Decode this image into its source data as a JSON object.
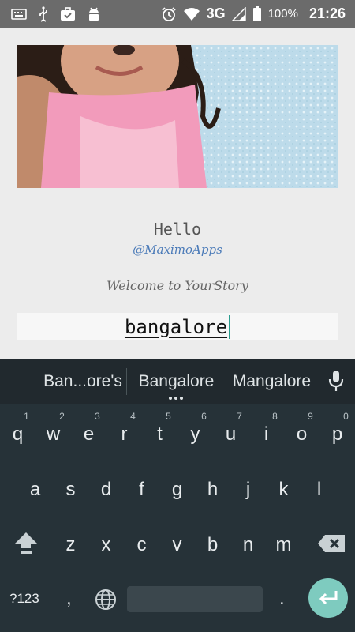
{
  "status_bar": {
    "network": "3G",
    "battery": "100%",
    "time": "21:26"
  },
  "content": {
    "greeting": "Hello",
    "handle": "@MaximoApps",
    "welcome": "Welcome to YourStory",
    "input_value": "bangalore"
  },
  "keyboard": {
    "suggestions": [
      "Ban...ore's",
      "Bangalore",
      "Mangalore"
    ],
    "row1": [
      {
        "key": "q",
        "num": "1"
      },
      {
        "key": "w",
        "num": "2"
      },
      {
        "key": "e",
        "num": "3"
      },
      {
        "key": "r",
        "num": "4"
      },
      {
        "key": "t",
        "num": "5"
      },
      {
        "key": "y",
        "num": "6"
      },
      {
        "key": "u",
        "num": "7"
      },
      {
        "key": "i",
        "num": "8"
      },
      {
        "key": "o",
        "num": "9"
      },
      {
        "key": "p",
        "num": "0"
      }
    ],
    "row2": [
      "a",
      "s",
      "d",
      "f",
      "g",
      "h",
      "j",
      "k",
      "l"
    ],
    "row3": [
      "z",
      "x",
      "c",
      "v",
      "b",
      "n",
      "m"
    ],
    "symbols_label": "?123",
    "comma": ",",
    "period": "."
  },
  "colors": {
    "status_bar": "#6b6b6b",
    "keyboard_bg": "#263238",
    "accent": "#7ecbbf",
    "handle_blue": "#4a7ab8"
  }
}
